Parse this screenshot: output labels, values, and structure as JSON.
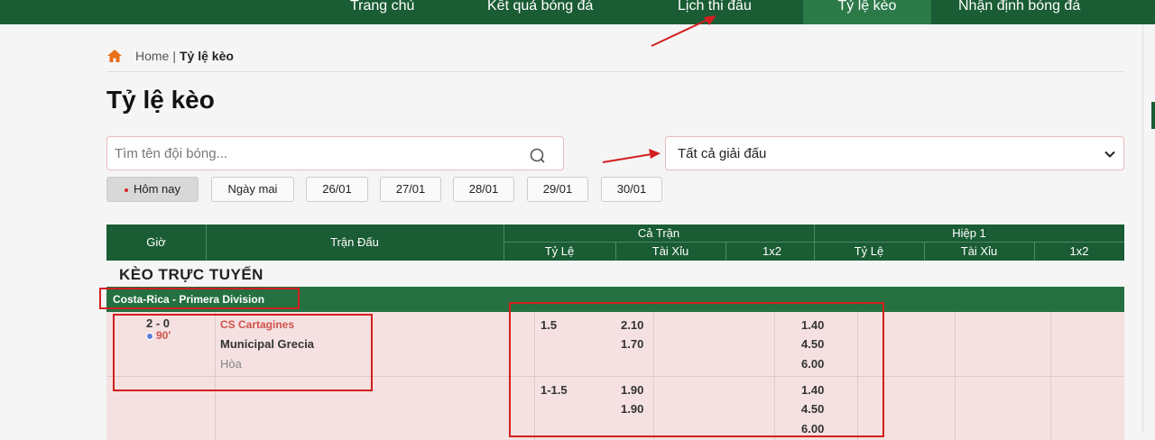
{
  "nav": {
    "items": [
      {
        "label": "Trang chủ"
      },
      {
        "label": "Kết quả bóng đá"
      },
      {
        "label": "Lịch thi đấu"
      },
      {
        "label": "Tỷ lệ kèo"
      },
      {
        "label": "Nhận định bóng đá"
      }
    ],
    "active": "Tỷ lệ kèo"
  },
  "breadcrumb": {
    "home": "Home",
    "separator": "|",
    "current": "Tỷ lệ kèo"
  },
  "page_title": "Tỷ lệ kèo",
  "search": {
    "placeholder": "Tìm tên đội bóng..."
  },
  "league_select": {
    "value": "Tất cả giải đấu"
  },
  "dates": [
    "Hôm nay",
    "Ngày mai",
    "26/01",
    "27/01",
    "28/01",
    "29/01",
    "30/01"
  ],
  "table": {
    "headers": {
      "time": "Giờ",
      "match": "Trận Đấu",
      "full_time": "Cả Trận",
      "half1": "Hiệp 1",
      "handicap": "Tỷ Lệ",
      "over_under": "Tài Xỉu",
      "one_x_two": "1x2"
    },
    "section_title": "KÈO TRỰC TUYẾN",
    "league": "Costa-Rica - Primera Division",
    "match": {
      "score": "2 - 0",
      "minute": "90'",
      "home": "CS Cartagines",
      "away": "Municipal Grecia",
      "draw": "Hòa"
    },
    "odds_rows": [
      {
        "handicap": "1.5",
        "ou": [
          "2.10",
          "1.70"
        ],
        "x12": [
          "1.40",
          "4.50",
          "6.00"
        ]
      },
      {
        "handicap": "1-1.5",
        "ou": [
          "1.90",
          "1.90"
        ],
        "x12": [
          "1.40",
          "4.50",
          "6.00"
        ]
      }
    ]
  },
  "colors": {
    "header_green": "#1a5c34",
    "league_green": "#247040",
    "row_pink": "#f5e1e1",
    "annotation_red": "#d21f1f"
  }
}
